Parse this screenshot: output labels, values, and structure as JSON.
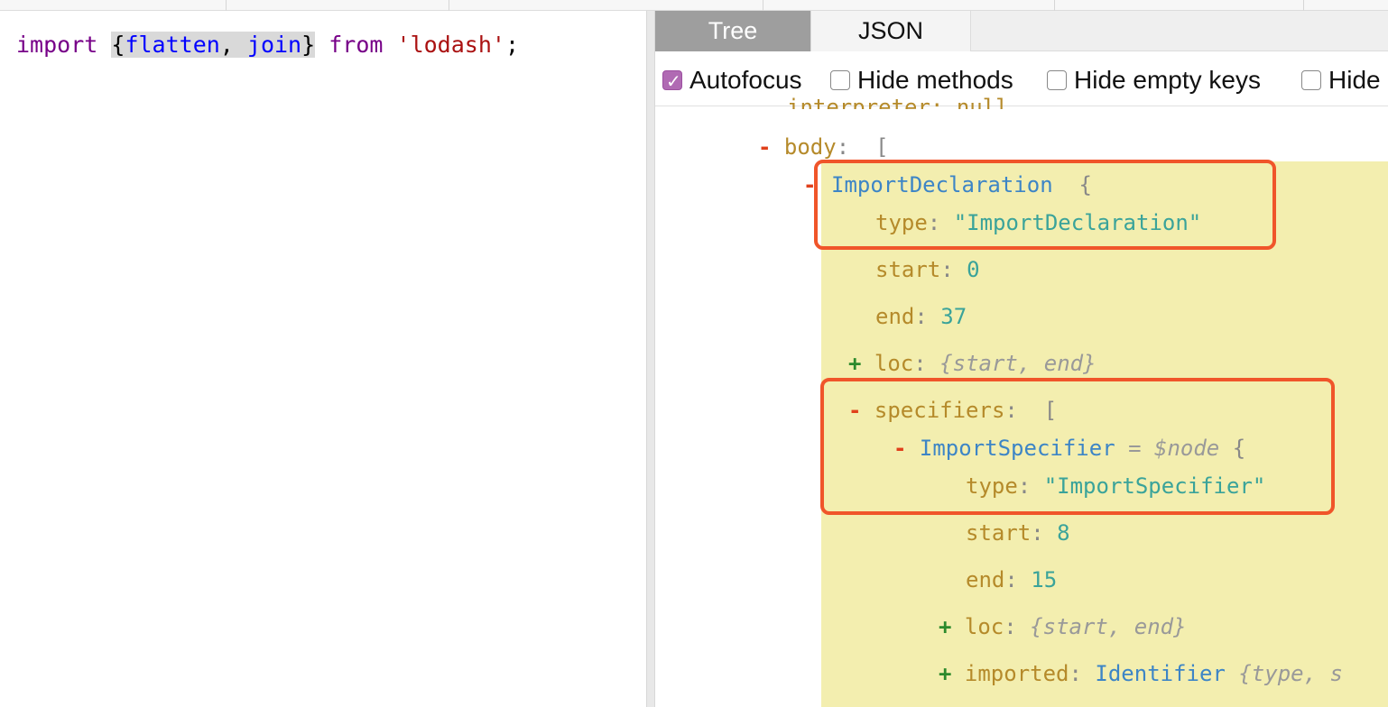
{
  "editor": {
    "code": {
      "kw_import": "import",
      "open_brace": "{",
      "flatten": "flatten",
      "comma": ", ",
      "join": "join",
      "close_brace": "}",
      "kw_from": "from",
      "source": "'lodash'",
      "semicolon": ";"
    }
  },
  "output": {
    "tabs": [
      {
        "label": "Tree",
        "active": true
      },
      {
        "label": "JSON",
        "active": false
      }
    ],
    "options": [
      {
        "label": "Autofocus",
        "checked": true
      },
      {
        "label": "Hide methods",
        "checked": false
      },
      {
        "label": "Hide empty keys",
        "checked": false
      },
      {
        "label": "Hide",
        "checked": false
      }
    ],
    "tree": {
      "cut_row": "interpreter: null",
      "body_key": "body",
      "body_open": "[",
      "import_decl_type": "ImportDeclaration",
      "import_decl_brace": "{",
      "type_key": "type",
      "import_decl_type_value": "\"ImportDeclaration\"",
      "start_key": "start",
      "start_value": "0",
      "end_key": "end",
      "end_value": "37",
      "loc_key": "loc",
      "loc_summary": "{start, end}",
      "specifiers_key": "specifiers",
      "specifiers_open": "[",
      "import_spec_type": "ImportSpecifier",
      "node_alias": "= $node",
      "import_spec_brace": "{",
      "import_spec_type_value": "\"ImportSpecifier\"",
      "spec_start_value": "8",
      "spec_end_value": "15",
      "imported_key": "imported",
      "imported_type": "Identifier",
      "imported_summary": "{type, s"
    }
  },
  "colors": {
    "highlight": "#f3eeaf",
    "annotation_box": "#f0552a",
    "active_tab": "#9e9e9e",
    "checkbox_checked": "#b06ab3"
  }
}
